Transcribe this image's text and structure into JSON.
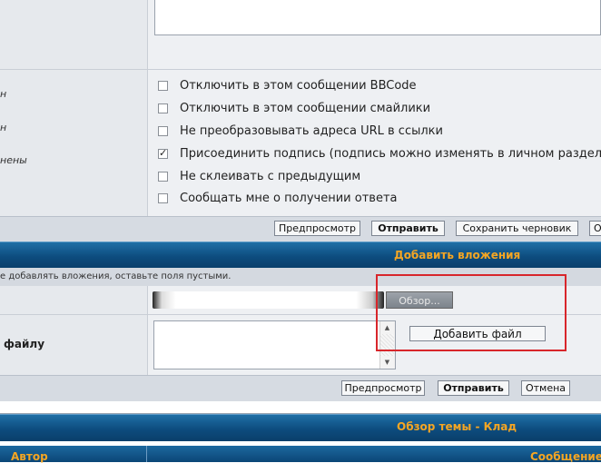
{
  "options": {
    "left_labels": [
      "н",
      "н",
      "нены"
    ],
    "items": [
      {
        "label": "Отключить в этом сообщении BBCode",
        "checked": false
      },
      {
        "label": "Отключить в этом сообщении смайлики",
        "checked": false
      },
      {
        "label": "Не преобразовывать адреса URL в ссылки",
        "checked": false
      },
      {
        "label": "Присоединить подпись (подпись можно изменять в личном разделе",
        "checked": true
      },
      {
        "label": "Не склеивать с предыдущим",
        "checked": false
      },
      {
        "label": "Сообщать мне о получении ответа",
        "checked": false
      }
    ]
  },
  "toolbar1": {
    "preview": "Предпросмотр",
    "submit": "Отправить",
    "save_draft": "Сохранить черновик",
    "cut": "О"
  },
  "attachments": {
    "title": "Добавить вложения",
    "hint": "е добавлять вложения, оставьте поля пустыми.",
    "browse": "Обзор...",
    "comment_label": "файлу",
    "add_file": "Добавить файл"
  },
  "toolbar2": {
    "preview": "Предпросмотр",
    "submit": "Отправить",
    "cancel": "Отмена"
  },
  "topic_review": {
    "title": "Обзор темы - Клад",
    "author_col": "Автор",
    "message_col": "Сообщение"
  },
  "colors": {
    "header_text": "#f5a623",
    "header_bg": "#0d4c7e",
    "highlight": "#d8262b"
  }
}
